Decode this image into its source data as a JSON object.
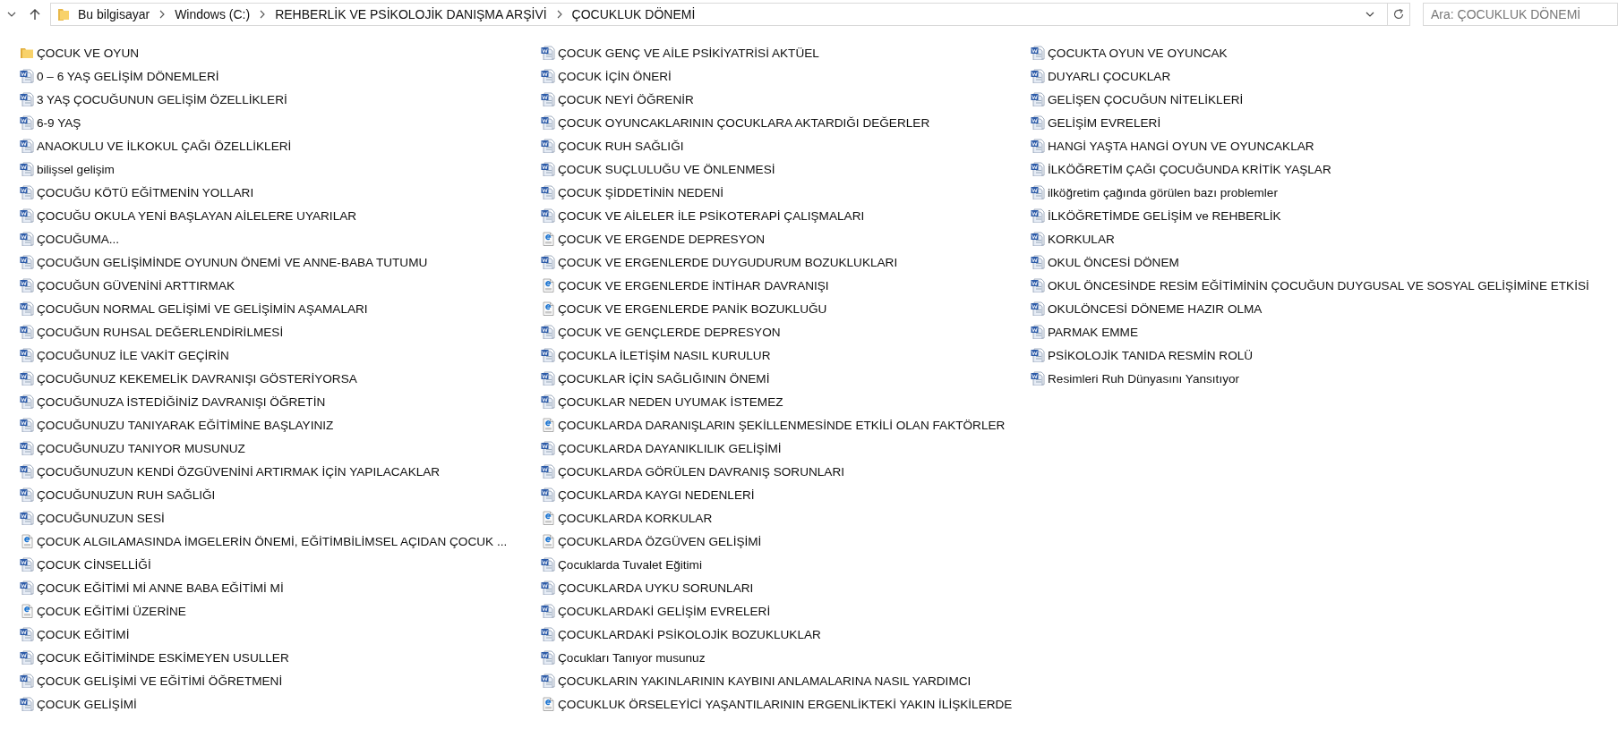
{
  "address_bar": {
    "segments": [
      "Bu bilgisayar",
      "Windows (C:)",
      "REHBERLİK VE PSİKOLOJİK DANIŞMA ARŞİVİ",
      "ÇOCUKLUK DÖNEMİ"
    ]
  },
  "search": {
    "placeholder": "Ara: ÇOCUKLUK DÖNEMİ"
  },
  "items": [
    {
      "kind": "folder",
      "name": "ÇOCUK VE OYUN"
    },
    {
      "kind": "word",
      "name": "0 – 6 YAŞ GELİŞİM DÖNEMLERİ"
    },
    {
      "kind": "word",
      "name": "3 YAŞ ÇOCUĞUNUN GELİŞİM ÖZELLİKLERİ"
    },
    {
      "kind": "word",
      "name": "6-9 YAŞ"
    },
    {
      "kind": "word",
      "name": "ANAOKULU  VE İLKOKUL ÇAĞI ÖZELLİKLERİ"
    },
    {
      "kind": "word",
      "name": "bilişsel gelişim"
    },
    {
      "kind": "word",
      "name": "ÇOCUĞU  KÖTÜ  EĞİTMENİN  YOLLARI"
    },
    {
      "kind": "word",
      "name": "ÇOCUĞU OKULA YENİ BAŞLAYAN AİLELERE UYARILAR"
    },
    {
      "kind": "word",
      "name": "ÇOCUĞUMA..."
    },
    {
      "kind": "word",
      "name": "ÇOCUĞUN GELİŞİMİNDE OYUNUN ÖNEMİ VE ANNE-BABA TUTUMU"
    },
    {
      "kind": "word",
      "name": "ÇOCUĞUN GÜVENİNİ ARTTIRMAK"
    },
    {
      "kind": "word",
      "name": "ÇOCUĞUN NORMAL GELİŞİMİ VE GELİŞİMİN AŞAMALARI"
    },
    {
      "kind": "word",
      "name": "ÇOCUĞUN RUHSAL DEĞERLENDİRİLMESİ"
    },
    {
      "kind": "word",
      "name": "ÇOCUĞUNUZ İLE VAKİT GEÇİRİN"
    },
    {
      "kind": "word",
      "name": "ÇOCUĞUNUZ KEKEMELİK DAVRANIŞI GÖSTERİYORSA"
    },
    {
      "kind": "word",
      "name": "ÇOCUĞUNUZA İSTEDİĞİNİZ DAVRANIŞI ÖĞRETİN"
    },
    {
      "kind": "word",
      "name": "ÇOCUĞUNUZU TANIYARAK EĞİTİMİNE BAŞLAYINIZ"
    },
    {
      "kind": "word",
      "name": "ÇOCUĞUNUZU TANIYOR MUSUNUZ"
    },
    {
      "kind": "word",
      "name": "ÇOCUĞUNUZUN KENDİ ÖZGÜVENİNİ ARTIRMAK İÇİN YAPILACAKLAR"
    },
    {
      "kind": "word",
      "name": "ÇOCUĞUNUZUN RUH SAĞLIĞI"
    },
    {
      "kind": "word",
      "name": "ÇOCUĞUNUZUN SESİ"
    },
    {
      "kind": "pdf",
      "name": "ÇOCUK ALGILAMASINDA İMGELERİN ÖNEMİ, EĞİTİMBİLİMSEL AÇIDAN ÇOCUK ..."
    },
    {
      "kind": "word",
      "name": "ÇOCUK CİNSELLİĞİ"
    },
    {
      "kind": "word",
      "name": "ÇOCUK EĞİTİMİ Mİ ANNE BABA EĞİTİMİ Mİ"
    },
    {
      "kind": "pdf",
      "name": "ÇOCUK EĞİTİMİ ÜZERİNE"
    },
    {
      "kind": "word",
      "name": "ÇOCUK EĞİTİMİ"
    },
    {
      "kind": "word",
      "name": "ÇOCUK EĞİTİMİNDE ESKİMEYEN USULLER"
    },
    {
      "kind": "word",
      "name": "ÇOCUK GELİŞİMİ VE EĞİTİMİ ÖĞRETMENİ"
    },
    {
      "kind": "word",
      "name": "ÇOCUK GELİŞİMİ"
    },
    {
      "kind": "word",
      "name": "ÇOCUK GENÇ VE AİLE PSİKİYATRİSİ AKTÜEL"
    },
    {
      "kind": "word",
      "name": "ÇOCUK İÇİN ÖNERİ"
    },
    {
      "kind": "word",
      "name": "ÇOCUK NEYİ ÖĞRENİR"
    },
    {
      "kind": "word",
      "name": "ÇOCUK OYUNCAKLARININ ÇOCUKLARA AKTARDIĞI DEĞERLER"
    },
    {
      "kind": "word",
      "name": "ÇOCUK RUH SAĞLIĞI"
    },
    {
      "kind": "word",
      "name": "ÇOCUK SUÇLULUĞU VE ÖNLENMESİ"
    },
    {
      "kind": "word",
      "name": "ÇOCUK ŞİDDETİNİN NEDENİ"
    },
    {
      "kind": "word",
      "name": "ÇOCUK VE AİLELER İLE PSİKOTERAPİ ÇALIŞMALARI"
    },
    {
      "kind": "pdf",
      "name": "ÇOCUK VE ERGENDE DEPRESYON"
    },
    {
      "kind": "word",
      "name": "ÇOCUK VE ERGENLERDE DUYGUDURUM BOZUKLUKLARI"
    },
    {
      "kind": "pdf",
      "name": "ÇOCUK VE ERGENLERDE İNTİHAR DAVRANIŞI"
    },
    {
      "kind": "pdf",
      "name": "ÇOCUK VE ERGENLERDE PANİK BOZUKLUĞU"
    },
    {
      "kind": "word",
      "name": "ÇOCUK VE GENÇLERDE DEPRESYON"
    },
    {
      "kind": "word",
      "name": "ÇOCUKLA İLETİŞİM NASIL KURULUR"
    },
    {
      "kind": "word",
      "name": "ÇOCUKLAR İÇİN SAĞLIĞININ ÖNEMİ"
    },
    {
      "kind": "word",
      "name": "ÇOCUKLAR NEDEN UYUMAK İSTEMEZ"
    },
    {
      "kind": "pdf",
      "name": "ÇOCUKLARDA DARANIŞLARIN ŞEKİLLENMESİNDE ETKİLİ OLAN FAKTÖRLER"
    },
    {
      "kind": "word",
      "name": "ÇOCUKLARDA DAYANIKLILIK GELİŞİMİ"
    },
    {
      "kind": "word",
      "name": "ÇOCUKLARDA GÖRÜLEN DAVRANIŞ SORUNLARI"
    },
    {
      "kind": "word",
      "name": "ÇOCUKLARDA KAYGI NEDENLERİ"
    },
    {
      "kind": "pdf",
      "name": "ÇOCUKLARDA KORKULAR"
    },
    {
      "kind": "pdf",
      "name": "ÇOCUKLARDA ÖZGÜVEN GELİŞİMİ"
    },
    {
      "kind": "word",
      "name": "Çocuklarda Tuvalet Eğitimi"
    },
    {
      "kind": "word",
      "name": "ÇOCUKLARDA UYKU SORUNLARI"
    },
    {
      "kind": "word",
      "name": "ÇOCUKLARDAKİ GELİŞİM EVRELERİ"
    },
    {
      "kind": "word",
      "name": "ÇOCUKLARDAKİ PSİKOLOJİK BOZUKLUKLAR"
    },
    {
      "kind": "word",
      "name": "Çocukları Tanıyor musunuz"
    },
    {
      "kind": "word",
      "name": "ÇOCUKLARIN YAKINLARININ KAYBINI ANLAMALARINA NASIL YARDIMCI"
    },
    {
      "kind": "pdf",
      "name": "ÇOCUKLUK ÖRSELEYİCİ YAŞANTILARININ ERGENLİKTEKİ YAKIN İLİŞKİLERDE"
    },
    {
      "kind": "word",
      "name": "ÇOCUKTA OYUN VE OYUNCAK"
    },
    {
      "kind": "word",
      "name": "DUYARLI ÇOCUKLAR"
    },
    {
      "kind": "word",
      "name": "GELİŞEN ÇOCUĞUN NİTELİKLERİ"
    },
    {
      "kind": "word",
      "name": "GELİŞİM EVRELERİ"
    },
    {
      "kind": "word",
      "name": "HANGİ YAŞTA  HANGİ  OYUN VE OYUNCAKLAR"
    },
    {
      "kind": "word",
      "name": "İLKÖĞRETİM ÇAĞI ÇOCUĞUNDA KRİTİK YAŞLAR"
    },
    {
      "kind": "word",
      "name": "ilköğretim çağında görülen bazı problemler"
    },
    {
      "kind": "word",
      "name": "İLKÖĞRETİMDE GELİŞİM ve REHBERLİK"
    },
    {
      "kind": "word",
      "name": "KORKULAR"
    },
    {
      "kind": "word",
      "name": "OKUL ÖNCESİ DÖNEM"
    },
    {
      "kind": "word",
      "name": "OKUL ÖNCESİNDE RESİM EĞİTİMİNİN ÇOCUĞUN DUYGUSAL VE SOSYAL GELİŞİMİNE ETKİSİ"
    },
    {
      "kind": "word",
      "name": "OKULÖNCESİ DÖNEME HAZIR OLMA"
    },
    {
      "kind": "word",
      "name": "PARMAK EMME"
    },
    {
      "kind": "word",
      "name": "PSİKOLOJİK TANIDA RESMİN ROLÜ"
    },
    {
      "kind": "word",
      "name": "Resimleri Ruh Dünyasını Yansıtıyor"
    }
  ]
}
